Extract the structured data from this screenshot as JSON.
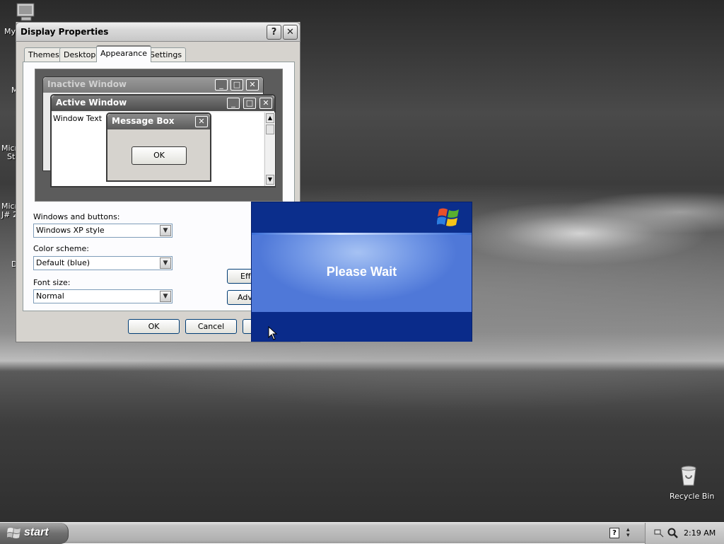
{
  "desktop": {
    "icons": [
      {
        "label": "My"
      },
      {
        "label": "M"
      },
      {
        "label": "Micr"
      },
      {
        "label": "St"
      },
      {
        "label": "Micr"
      },
      {
        "label": "J# 2"
      },
      {
        "label": "D"
      },
      {
        "label": "Recycle Bin"
      }
    ]
  },
  "display_properties": {
    "title": "Display Properties",
    "help_button": "?",
    "close_button": "✕",
    "tabs": [
      {
        "label": "Themes"
      },
      {
        "label": "Desktop"
      },
      {
        "label": "Appearance"
      },
      {
        "label": "Settings"
      }
    ],
    "preview": {
      "inactive_title": "Inactive Window",
      "active_title": "Active Window",
      "window_text": "Window Text",
      "message_box_title": "Message Box",
      "message_box_ok": "OK"
    },
    "windows_and_buttons_label": "Windows and buttons:",
    "windows_and_buttons_value": "Windows XP style",
    "color_scheme_label": "Color scheme:",
    "color_scheme_value": "Default (blue)",
    "font_size_label": "Font size:",
    "font_size_value": "Normal",
    "effects_button": "Eff",
    "advanced_button": "Adv",
    "ok_button": "OK",
    "cancel_button": "Cancel"
  },
  "splash": {
    "message": "Please Wait"
  },
  "taskbar": {
    "start_label": "start",
    "clock": "2:19 AM"
  },
  "colors": {
    "splash_blue": "#0b2f8f",
    "splash_mid": "#6f95e5",
    "dialog_face": "#d6d3ce"
  }
}
